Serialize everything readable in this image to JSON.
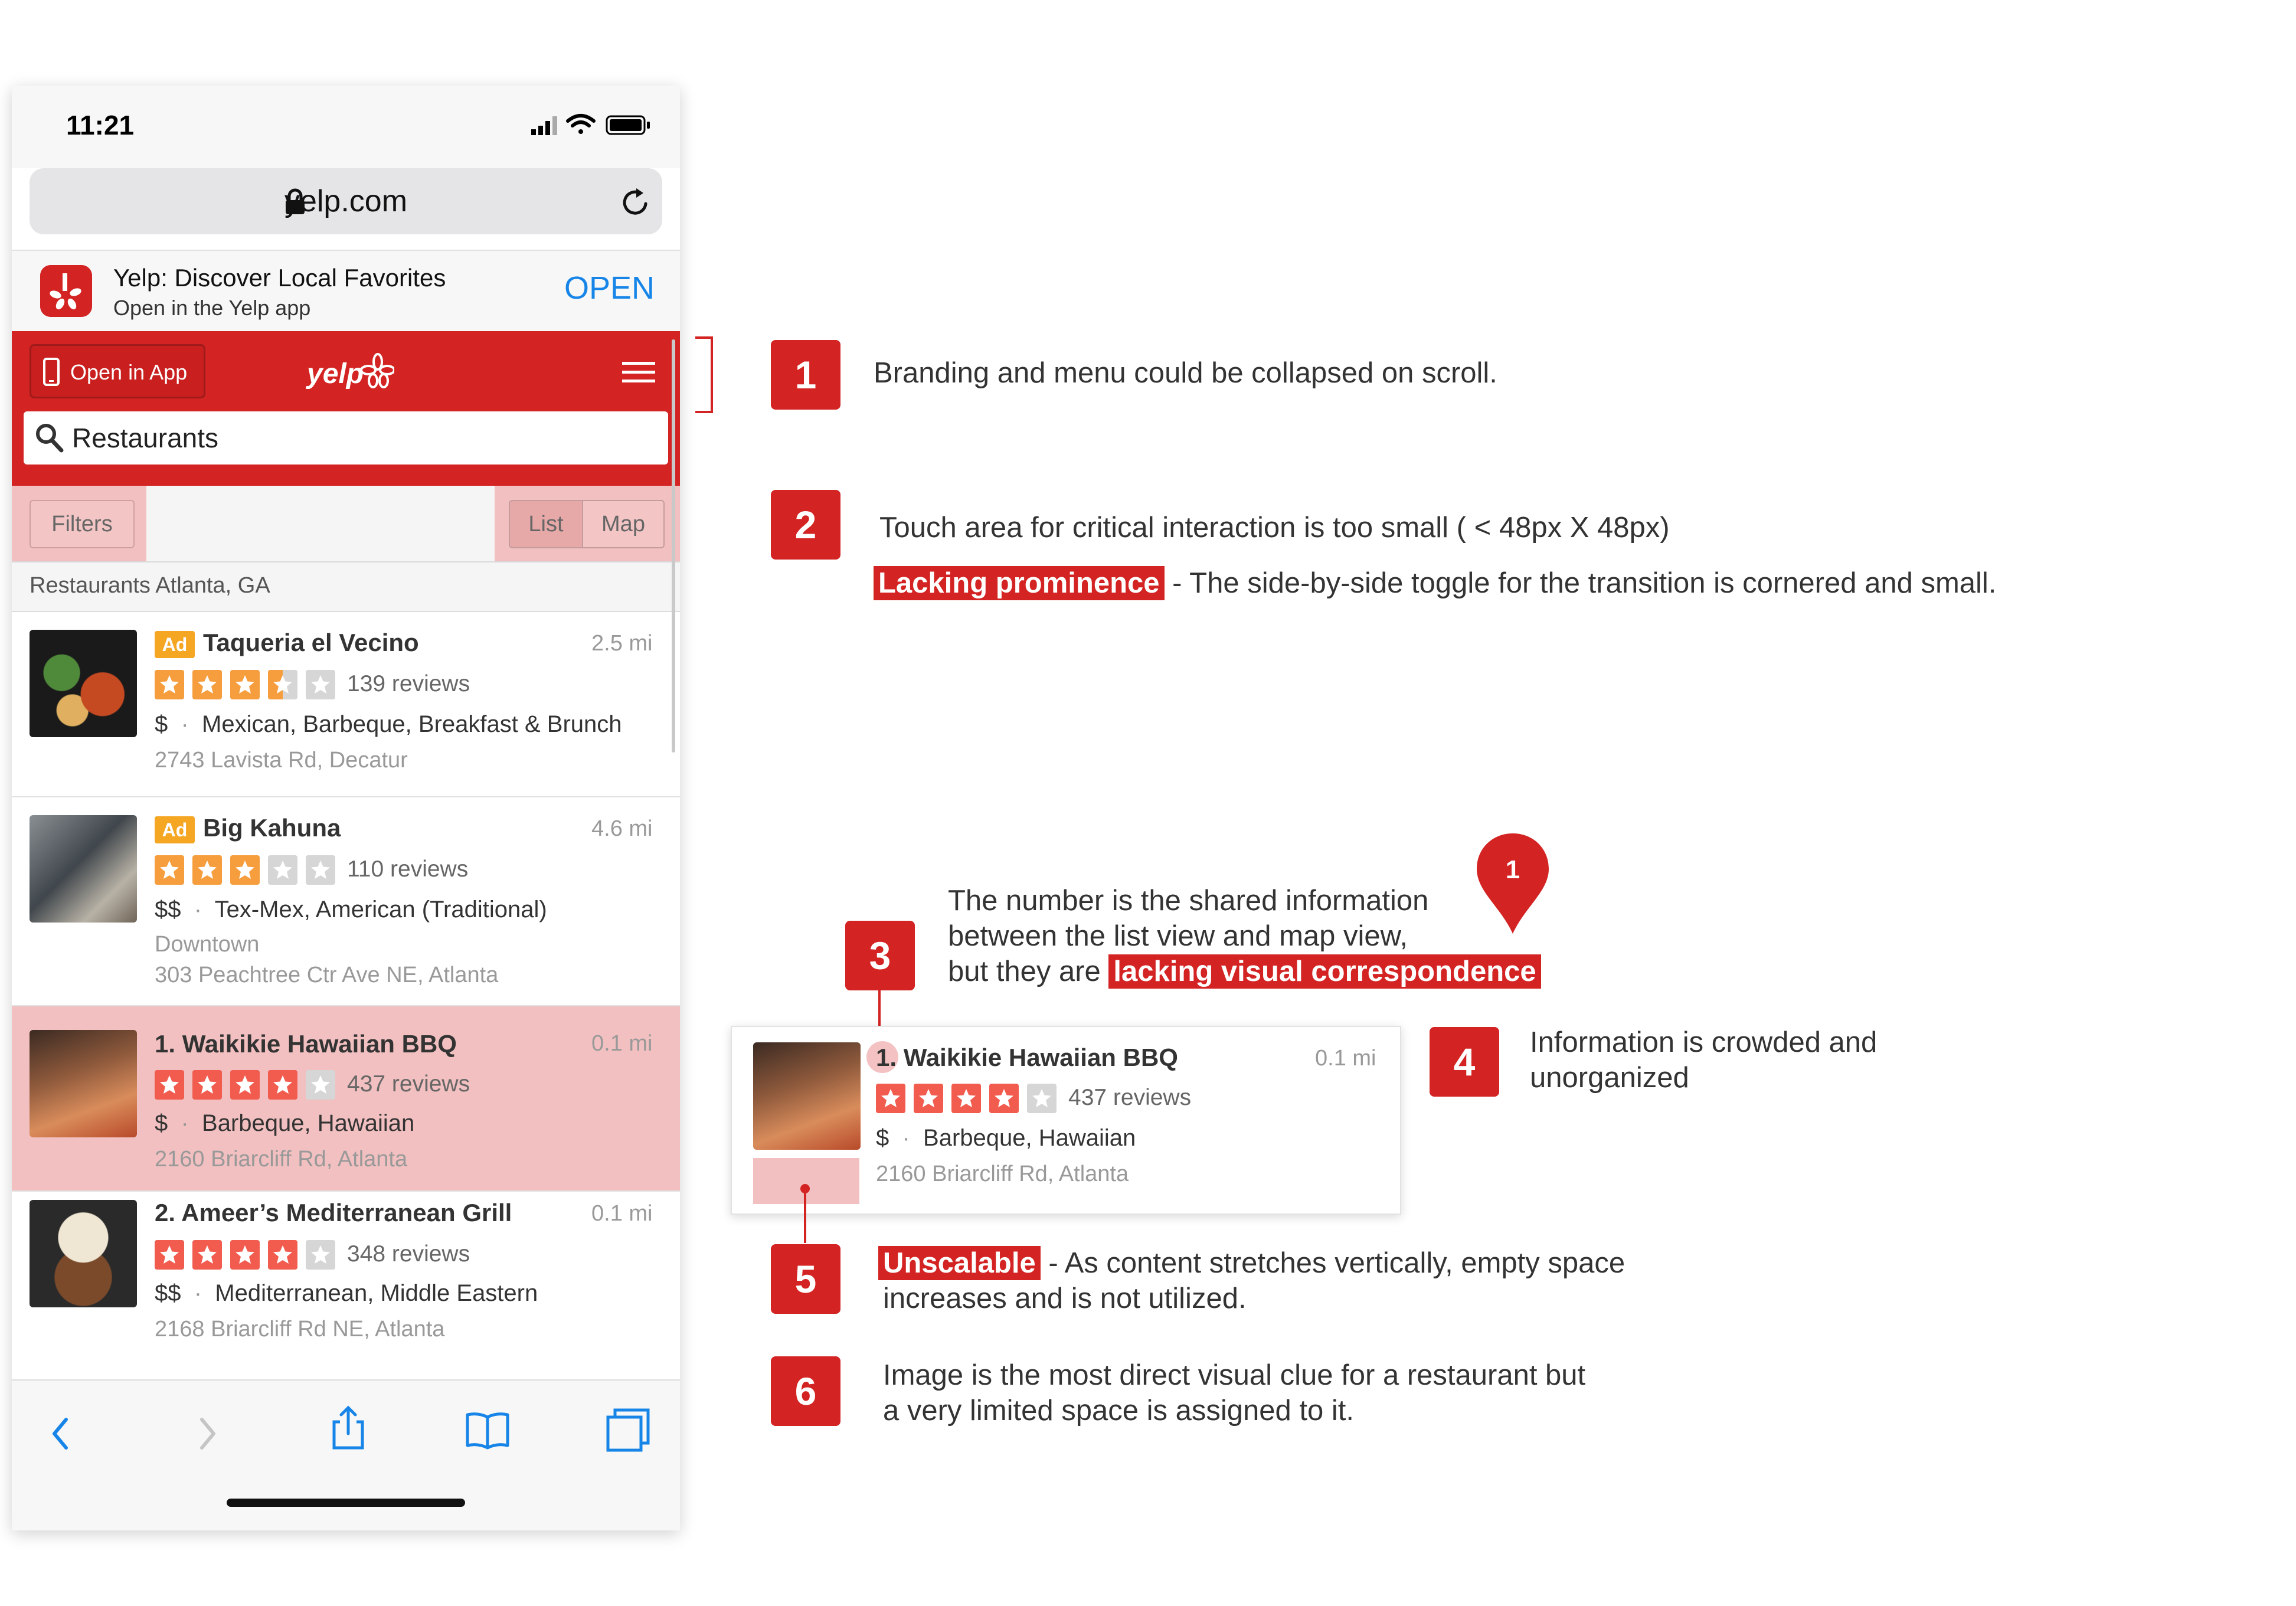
{
  "colors": {
    "yelp_red": "#d32323",
    "highlight_pink": "#f2c0c0",
    "star_red": "#f15c4f",
    "star_orange": "#f69d3d",
    "star_empty": "#d6d6d6",
    "link_blue": "#1785e8",
    "ad_orange": "#f5a623"
  },
  "phone": {
    "status": {
      "time": "11:21",
      "icons": [
        "cellular-icon",
        "wifi-icon",
        "battery-icon"
      ]
    },
    "browser": {
      "url": "yelp.com",
      "icons": [
        "lock-icon",
        "reload-icon"
      ]
    },
    "app_banner": {
      "title": "Yelp: Discover Local Favorites",
      "subtitle": "Open in the Yelp app",
      "open_label": "OPEN"
    },
    "header": {
      "open_in_app": "Open in App",
      "logo_text": "yelp",
      "search_value": "Restaurants"
    },
    "filter_bar": {
      "filters": "Filters",
      "list": "List",
      "map": "Map"
    },
    "section_label": "Restaurants Atlanta, GA",
    "listings": [
      {
        "ad": "Ad",
        "name": "Taqueria el Vecino",
        "distance": "2.5 mi",
        "rating": 3.5,
        "star_color": "orange",
        "reviews": "139 reviews",
        "price": "$",
        "categories": "Mexican, Barbeque, Breakfast & Brunch",
        "address": "2743 Lavista Rd, Decatur",
        "neighborhood": ""
      },
      {
        "ad": "Ad",
        "name": "Big Kahuna",
        "distance": "4.6 mi",
        "rating": 3,
        "star_color": "orange",
        "reviews": "110 reviews",
        "price": "$$",
        "categories": "Tex-Mex, American (Traditional)",
        "neighborhood": "Downtown",
        "address": "303 Peachtree Ctr Ave NE, Atlanta"
      },
      {
        "ad": "",
        "name": "1. Waikikie Hawaiian BBQ",
        "distance": "0.1 mi",
        "rating": 4,
        "star_color": "red",
        "reviews": "437 reviews",
        "price": "$",
        "categories": "Barbeque, Hawaiian",
        "address": "2160 Briarcliff Rd, Atlanta",
        "neighborhood": ""
      },
      {
        "ad": "",
        "name": "2. Ameer’s Mediterranean Grill",
        "distance": "0.1 mi",
        "rating": 4,
        "star_color": "red",
        "reviews": "348 reviews",
        "price": "$$",
        "categories": "Mediterranean, Middle Eastern",
        "address": "2168 Briarcliff Rd NE, Atlanta",
        "neighborhood": ""
      }
    ],
    "toolbar_icons": [
      "back-icon",
      "forward-icon",
      "share-icon",
      "bookmarks-icon",
      "tabs-icon"
    ]
  },
  "annotations": {
    "a1": {
      "num": "1",
      "text": "Branding and menu could be collapsed on scroll."
    },
    "a2": {
      "num": "2",
      "text": "Touch area for critical interaction is too small ( < 48px X 48px)",
      "highlight": "Lacking prominence",
      "rest": "- The side-by-side toggle for the transition is cornered and small."
    },
    "a3": {
      "num": "3",
      "line1": "The number is the shared information",
      "line2": "between the list view and map view,",
      "line3_pre": "but they are",
      "line3_highlight": "lacking visual correspondence",
      "pin_label": "1"
    },
    "zoom_card": {
      "num_prefix": "1.",
      "name": "Waikikie Hawaiian BBQ",
      "distance": "0.1 mi",
      "rating": 4,
      "reviews": "437 reviews",
      "price": "$",
      "categories": "Barbeque, Hawaiian",
      "address": "2160 Briarcliff Rd, Atlanta"
    },
    "a4": {
      "num": "4",
      "line1": "Information is crowded and",
      "line2": "unorganized"
    },
    "a5": {
      "num": "5",
      "highlight": "Unscalable",
      "line1_rest": "- As content stretches vertically, empty space",
      "line2": "increases and is not utilized."
    },
    "a6": {
      "num": "6",
      "line1": "Image is the most direct visual clue for a restaurant but",
      "line2": "a very limited space is assigned to it."
    }
  }
}
